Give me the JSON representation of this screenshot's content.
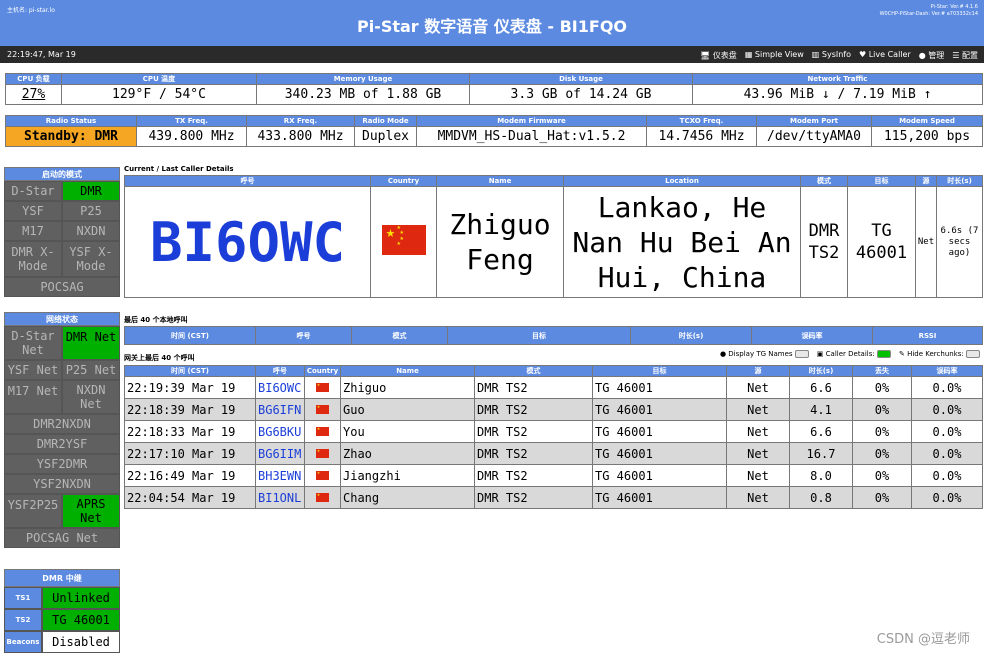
{
  "header": {
    "title": "Pi-Star 数字语音 仪表盘 - BI1FQO",
    "hostname": "主机名: pi-star.lo",
    "version1": "Pi-Star: Ver.# 4.1.6",
    "version2": "W0CHP-PiStar-Dash: Ver.# a703332c14"
  },
  "nav": {
    "time": "22:19:47, Mar 19",
    "links": [
      "仪表盘",
      "Simple View",
      "SysInfo",
      "Live Caller",
      "管理",
      "配置"
    ]
  },
  "sysinfo": {
    "headers": [
      "CPU 负载",
      "CPU 温度",
      "Memory Usage",
      "Disk Usage",
      "Network Traffic"
    ],
    "values": [
      "27%",
      "129°F / 54°C",
      "340.23 MB of 1.88 GB",
      "3.3 GB of 14.24 GB",
      "43.96 MiB ↓ / 7.19 MiB ↑"
    ]
  },
  "radio": {
    "headers": [
      "Radio Status",
      "TX Freq.",
      "RX Freq.",
      "Radio Mode",
      "Modem Firmware",
      "TCXO Freq.",
      "Modem Port",
      "Modem Speed"
    ],
    "values": [
      "Standby: DMR",
      "439.800 MHz",
      "433.800 MHz",
      "Duplex",
      "MMDVM_HS-Dual_Hat:v1.5.2",
      "14.7456 MHz",
      "/dev/ttyAMA0",
      "115,200 bps"
    ]
  },
  "modes": {
    "title": "启动的模式",
    "items": [
      {
        "label": "D-Star",
        "on": false
      },
      {
        "label": "DMR",
        "on": true
      },
      {
        "label": "YSF",
        "on": false
      },
      {
        "label": "P25",
        "on": false
      },
      {
        "label": "M17",
        "on": false
      },
      {
        "label": "NXDN",
        "on": false
      },
      {
        "label": "DMR X-Mode",
        "on": false
      },
      {
        "label": "YSF X-Mode",
        "on": false
      }
    ],
    "pocsag": "POCSAG"
  },
  "network": {
    "title": "网络状态",
    "items": [
      {
        "label": "D-Star Net",
        "on": false
      },
      {
        "label": "DMR Net",
        "on": true
      },
      {
        "label": "YSF Net",
        "on": false
      },
      {
        "label": "P25 Net",
        "on": false
      },
      {
        "label": "M17 Net",
        "on": false
      },
      {
        "label": "NXDN Net",
        "on": false
      }
    ],
    "wide": [
      "DMR2NXDN",
      "DMR2YSF",
      "YSF2DMR",
      "YSF2NXDN"
    ],
    "ysf2p25": "YSF2P25",
    "aprs": "APRS Net",
    "pocsag": "POCSAG Net"
  },
  "dmr": {
    "title": "DMR 中继",
    "rows": [
      {
        "label": "TS1",
        "value": "Unlinked"
      },
      {
        "label": "TS2",
        "value": "TG 46001"
      },
      {
        "label": "Beacons",
        "value": "Disabled"
      }
    ]
  },
  "current": {
    "caption": "Current / Last Caller Details",
    "headers": [
      "呼号",
      "Country",
      "Name",
      "Location",
      "模式",
      "目标",
      "源",
      "时长(s)"
    ],
    "callsign": "BI6OWC",
    "name": "Zhiguo Feng",
    "location": "Lankao, He Nan Hu Bei An Hui, China",
    "mode": "DMR TS2",
    "target": "TG 46001",
    "source": "Net",
    "duration": "6.6s (7 secs ago)"
  },
  "local": {
    "caption": "最后 40 个本地呼叫",
    "headers": [
      "时间 (CST)",
      "呼号",
      "模式",
      "目标",
      "时长(s)",
      "误码率",
      "RSSI"
    ]
  },
  "gateway": {
    "caption": "网关上最后 40 个呼叫",
    "toggles": [
      "Display TG Names",
      "Caller Details:",
      "Hide Kerchunks:"
    ],
    "headers": [
      "时间 (CST)",
      "呼号",
      "Country",
      "Name",
      "模式",
      "目标",
      "源",
      "时长(s)",
      "丢失",
      "误码率"
    ],
    "rows": [
      [
        "22:19:39 Mar 19",
        "BI6OWC",
        "Zhiguo",
        "DMR TS2",
        "TG 46001",
        "Net",
        "6.6",
        "0%",
        "0.0%"
      ],
      [
        "22:18:39 Mar 19",
        "BG6IFN",
        "Guo",
        "DMR TS2",
        "TG 46001",
        "Net",
        "4.1",
        "0%",
        "0.0%"
      ],
      [
        "22:18:33 Mar 19",
        "BG6BKU",
        "You",
        "DMR TS2",
        "TG 46001",
        "Net",
        "6.6",
        "0%",
        "0.0%"
      ],
      [
        "22:17:10 Mar 19",
        "BG6IIM",
        "Zhao",
        "DMR TS2",
        "TG 46001",
        "Net",
        "16.7",
        "0%",
        "0.0%"
      ],
      [
        "22:16:49 Mar 19",
        "BH3EWN",
        "Jiangzhi",
        "DMR TS2",
        "TG 46001",
        "Net",
        "8.0",
        "0%",
        "0.0%"
      ],
      [
        "22:04:54 Mar 19",
        "BI1ONL",
        "Chang",
        "DMR TS2",
        "TG 46001",
        "Net",
        "0.8",
        "0%",
        "0.0%"
      ]
    ]
  },
  "watermark": "CSDN @逗老师",
  "colors": {
    "accent": "#5b8ae0",
    "active": "#00b000",
    "standby": "#f5a623",
    "inactive": "#606060"
  }
}
